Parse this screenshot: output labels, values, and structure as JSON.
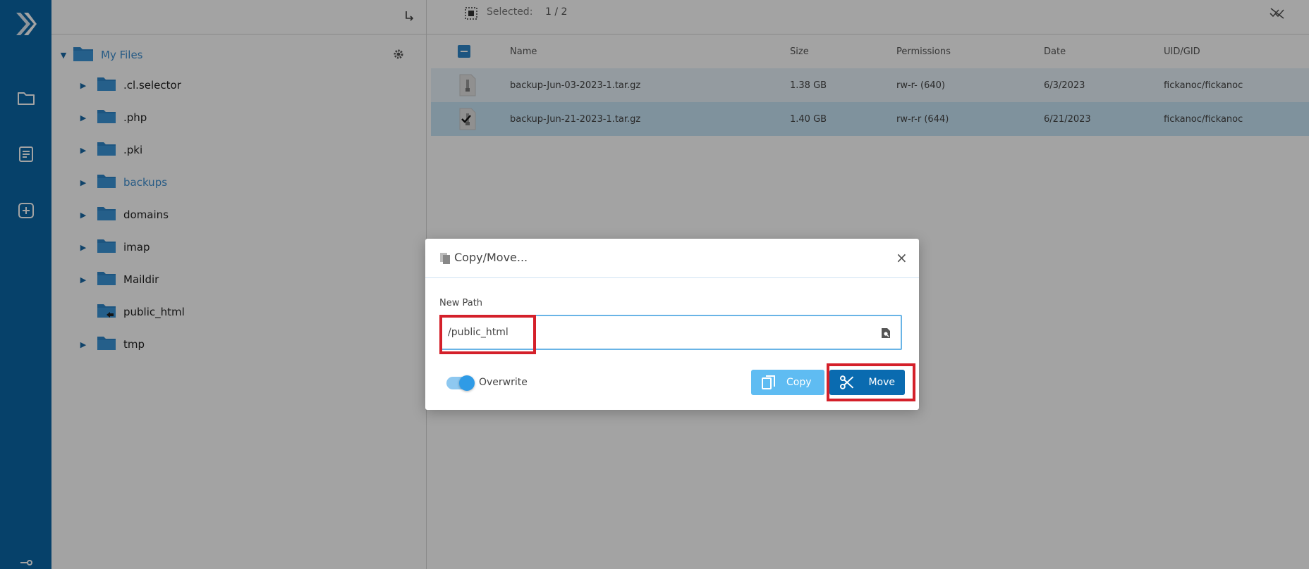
{
  "toolbar": {
    "selected_label": "Selected:",
    "selected_count": "1 / 2"
  },
  "tree": {
    "root": {
      "label": "My Files"
    },
    "items": [
      {
        "label": ".cl.selector",
        "has_caret": true
      },
      {
        "label": ".php",
        "has_caret": true
      },
      {
        "label": ".pki",
        "has_caret": true
      },
      {
        "label": "backups",
        "has_caret": true,
        "active": true
      },
      {
        "label": "domains",
        "has_caret": true
      },
      {
        "label": "imap",
        "has_caret": true
      },
      {
        "label": "Maildir",
        "has_caret": true
      },
      {
        "label": "public_html",
        "has_caret": false
      },
      {
        "label": "tmp",
        "has_caret": true
      }
    ]
  },
  "table": {
    "columns": [
      "Name",
      "Size",
      "Permissions",
      "Date",
      "UID/GID"
    ],
    "rows": [
      {
        "name": "backup-Jun-03-2023-1.tar.gz",
        "size": "1.38 GB",
        "permissions": "rw-r- (640)",
        "date": "6/3/2023",
        "uid_gid": "fickanoc/fickanoc",
        "checked": false
      },
      {
        "name": "backup-Jun-21-2023-1.tar.gz",
        "size": "1.40 GB",
        "permissions": "rw-r-r (644)",
        "date": "6/21/2023",
        "uid_gid": "fickanoc/fickanoc",
        "checked": true
      }
    ]
  },
  "dialog": {
    "title": "Copy/Move...",
    "path_label": "New Path",
    "path_value": "/public_html",
    "overwrite_label": "Overwrite",
    "overwrite_on": true,
    "copy_label": "Copy",
    "move_label": "Move"
  },
  "colors": {
    "rail": "#0a66a6",
    "accent": "#3d8fd1",
    "move_button": "#0a6bb0",
    "copy_button": "#5fbcf2",
    "highlight": "#d4202a"
  }
}
